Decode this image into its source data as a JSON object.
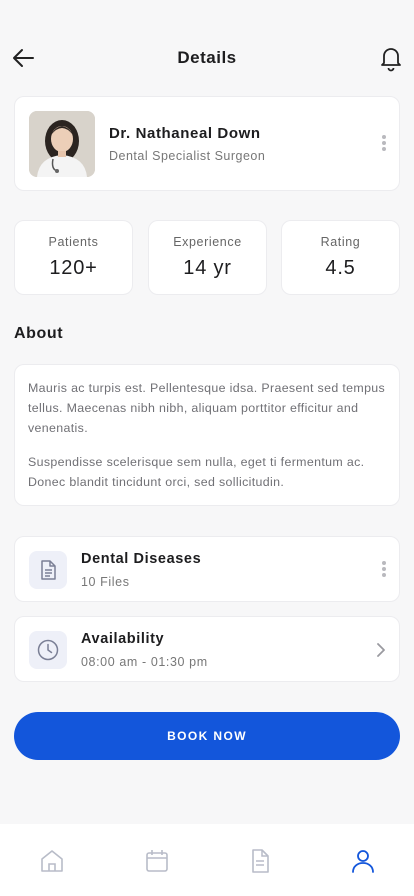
{
  "header": {
    "title": "Details",
    "back_icon": "arrow-left-icon",
    "bell_icon": "bell-icon"
  },
  "doctor": {
    "name": "Dr. Nathaneal Down",
    "specialty": "Dental Specialist Surgeon",
    "avatar_icon": "doctor-photo"
  },
  "stats": [
    {
      "label": "Patients",
      "value": "120+"
    },
    {
      "label": "Experience",
      "value": "14 yr"
    },
    {
      "label": "Rating",
      "value": "4.5"
    }
  ],
  "about": {
    "title": "About",
    "paragraphs": [
      "Mauris ac turpis est. Pellentesque idsa. Praesent sed tempus tellus. Maecenas nibh nibh, aliquam porttitor efficitur and venenatis.",
      "Suspendisse scelerisque sem nulla, eget ti fermentum ac. Donec blandit tincidunt orci, sed sollicitudin."
    ]
  },
  "rows": [
    {
      "title": "Dental Diseases",
      "subtitle": "10 Files",
      "icon": "document-icon",
      "action_icon": "kebab-icon"
    },
    {
      "title": "Availability",
      "subtitle": "08:00 am - 01:30 pm",
      "icon": "clock-icon",
      "action_icon": "chevron-right-icon"
    }
  ],
  "book_button": {
    "label": "BOOK NOW"
  },
  "tabs": [
    {
      "icon": "home-icon",
      "active": false
    },
    {
      "icon": "calendar-icon",
      "active": false
    },
    {
      "icon": "document-icon",
      "active": false
    },
    {
      "icon": "profile-icon",
      "active": true
    }
  ],
  "colors": {
    "accent": "#1356db",
    "icon_inactive": "#b8bcc8",
    "background": "#f7f7f8",
    "card": "#ffffff"
  }
}
